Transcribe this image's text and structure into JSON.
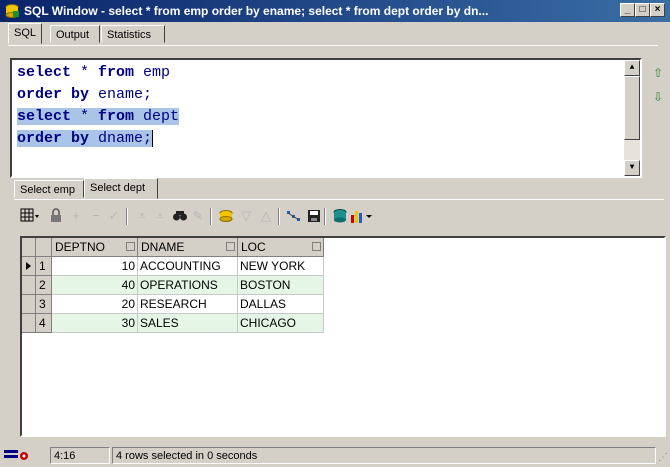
{
  "window": {
    "title": "SQL Window - select * from emp order by ename; select * from dept order by dn...",
    "min_label": "_",
    "max_label": "□",
    "close_label": "×"
  },
  "tabs_top": [
    "SQL",
    "Output",
    "Statistics"
  ],
  "editor": {
    "lines": [
      {
        "kw": "select",
        "mid": " * ",
        "kw2": "from",
        "id": " emp"
      },
      {
        "kw": "order by",
        "id": " ename;"
      },
      {
        "kw": "select",
        "mid": " * ",
        "kw2": "from",
        "id": " dept"
      },
      {
        "kw": "order by",
        "id": " dname;"
      }
    ]
  },
  "tabs_result": [
    "Select emp",
    "Select dept"
  ],
  "grid": {
    "columns": [
      "DEPTNO",
      "DNAME",
      "LOC"
    ],
    "rows": [
      {
        "n": "1",
        "deptno": "10",
        "dname": "ACCOUNTING",
        "loc": "NEW YORK"
      },
      {
        "n": "2",
        "deptno": "40",
        "dname": "OPERATIONS",
        "loc": "BOSTON"
      },
      {
        "n": "3",
        "deptno": "20",
        "dname": "RESEARCH",
        "loc": "DALLAS"
      },
      {
        "n": "4",
        "deptno": "30",
        "dname": "SALES",
        "loc": "CHICAGO"
      }
    ]
  },
  "status": {
    "position": "4:16",
    "message": "4 rows selected in 0 seconds"
  },
  "icons": {
    "app": "sql-window-icon",
    "toolbar": [
      "grid-view-icon",
      "lock-icon",
      "add-record-icon",
      "delete-record-icon",
      "post-record-icon",
      "filter-icon",
      "clear-filter-icon",
      "find-icon",
      "clear-icon",
      "query-by-example-icon",
      "next-page-icon",
      "last-page-icon",
      "export-icon",
      "save-icon",
      "print-icon",
      "chart-icon"
    ]
  }
}
